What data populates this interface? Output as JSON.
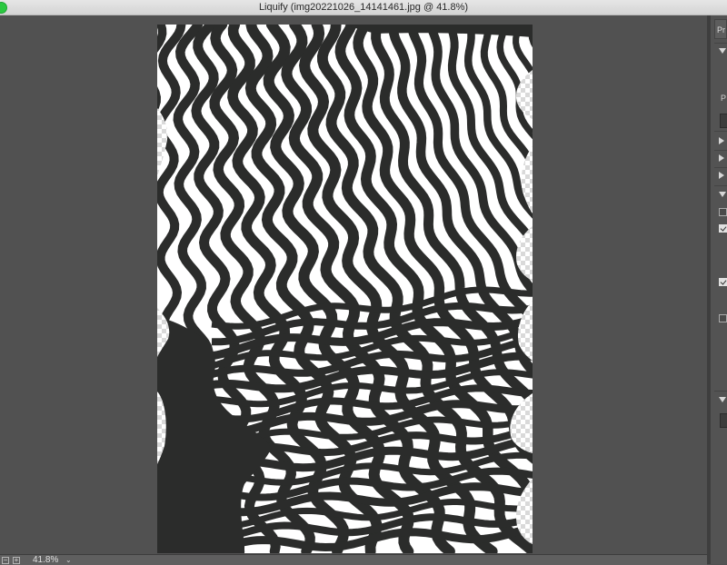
{
  "window": {
    "title": "Liquify (img20221026_14141461.jpg @ 41.8%)"
  },
  "status_bar": {
    "zoom_level": "41.8%",
    "zoom_out_symbol": "−",
    "zoom_in_symbol": "+",
    "dropdown_symbol": "⌄"
  },
  "right_panel": {
    "tab_label": "Pr",
    "field_label": "P"
  },
  "colors": {
    "workspace": "#515151",
    "ink": "#2b2c2b",
    "paper": "#ffffff",
    "transparency_checker": "#d9d9d9"
  }
}
